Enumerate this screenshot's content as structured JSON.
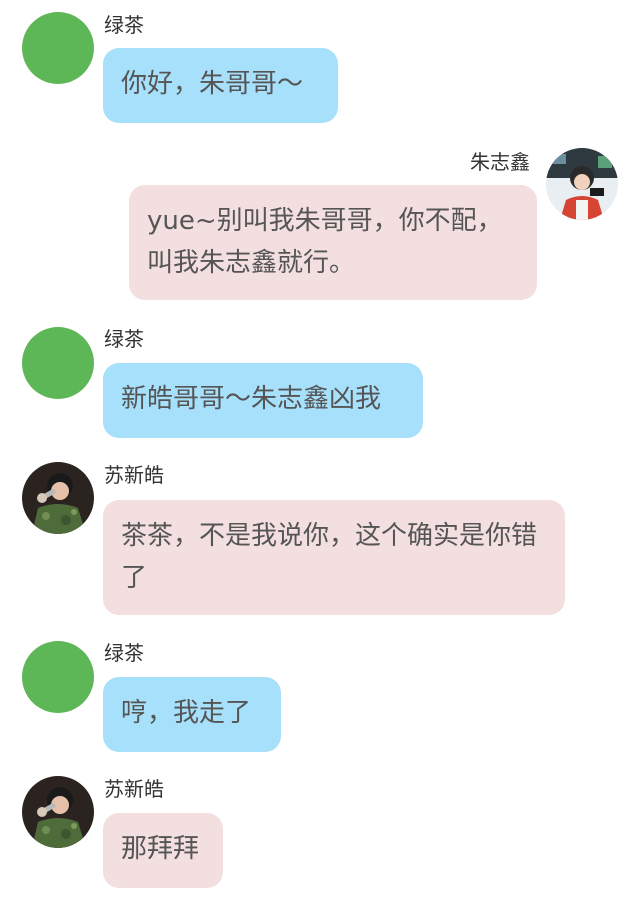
{
  "colors": {
    "green_avatar": "#5db756",
    "blue_bubble": "#a6e0fb",
    "pink_bubble": "#f3dfe0"
  },
  "messages": [
    {
      "sender": "绿茶",
      "side": "left",
      "avatar": "green-circle",
      "text": "你好，朱哥哥～"
    },
    {
      "sender": "朱志鑫",
      "side": "right",
      "avatar": "user-photo",
      "text": "yue~别叫我朱哥哥，你不配，叫我朱志鑫就行。"
    },
    {
      "sender": "绿茶",
      "side": "left",
      "avatar": "green-circle",
      "text": "新皓哥哥～朱志鑫凶我"
    },
    {
      "sender": "苏新皓",
      "side": "left",
      "avatar": "user-photo",
      "text": "茶茶，不是我说你，这个确实是你错了"
    },
    {
      "sender": "绿茶",
      "side": "left",
      "avatar": "green-circle",
      "text": "哼，我走了"
    },
    {
      "sender": "苏新皓",
      "side": "left",
      "avatar": "user-photo",
      "text": "那拜拜"
    }
  ]
}
